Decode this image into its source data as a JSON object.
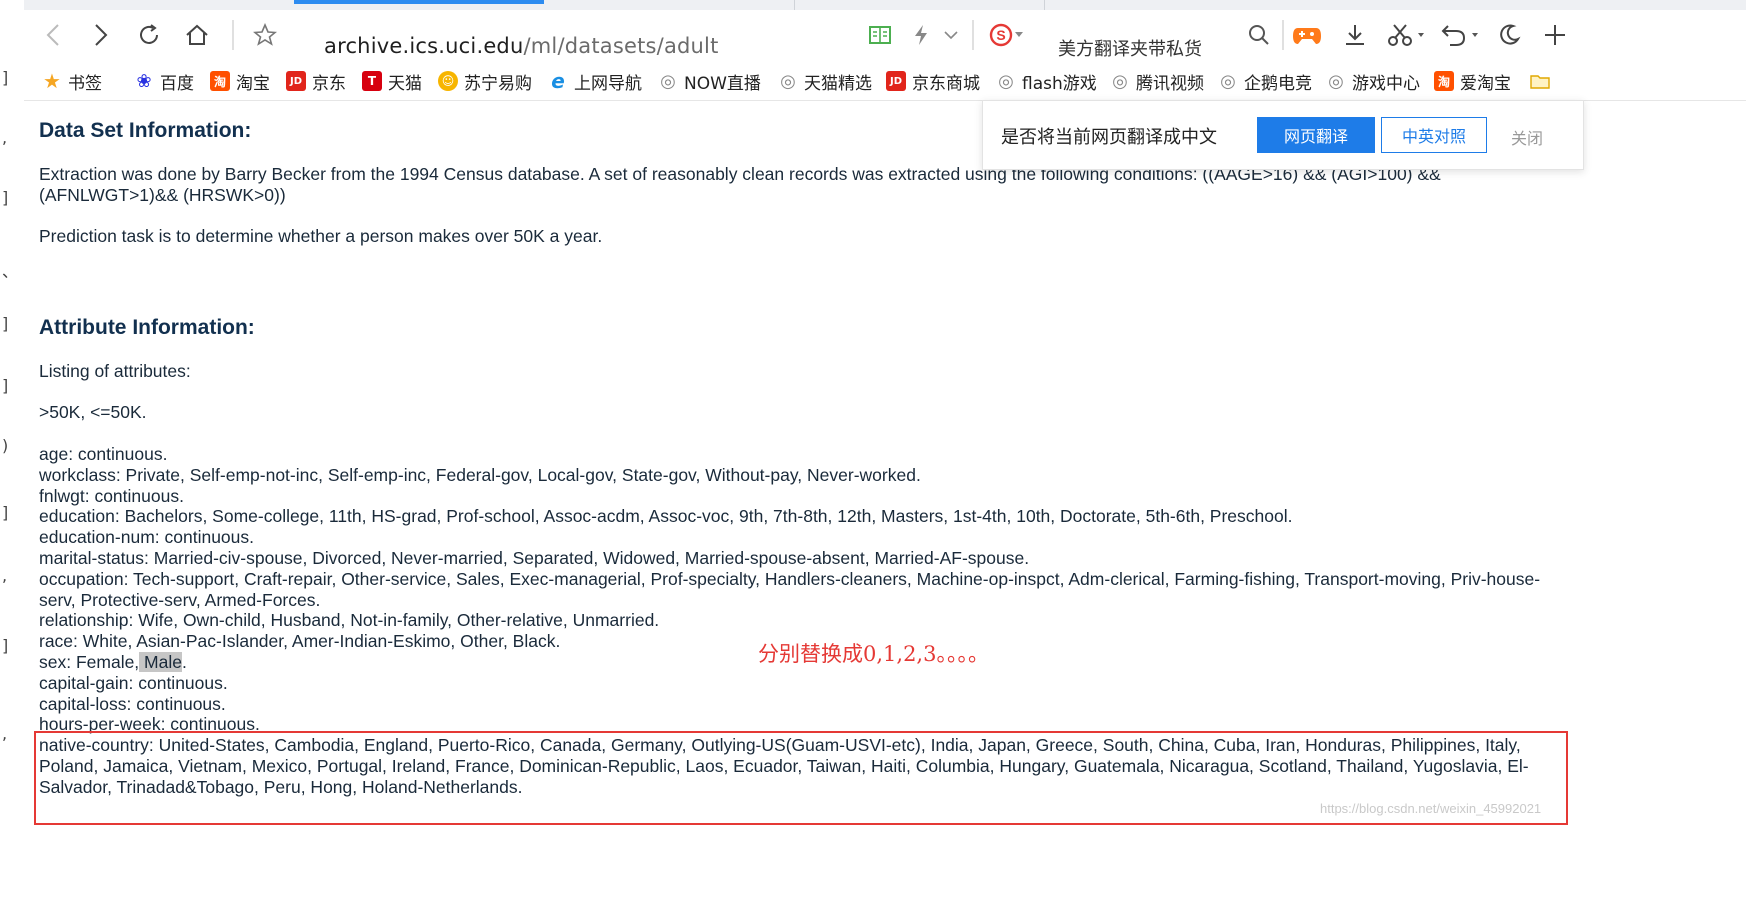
{
  "browser": {
    "url_host": "archive.ics.uci.edu",
    "url_path": "/ml/datasets/adult",
    "search_text": "美方翻译夹带私货"
  },
  "bookmarks": [
    {
      "label": "书签",
      "icon": "star-icon",
      "color": "#f5a623"
    },
    {
      "label": "百度",
      "icon": "baidu-paw-icon",
      "color": "#2932e1"
    },
    {
      "label": "淘宝",
      "icon": "taobao-icon",
      "color": "#ff5000"
    },
    {
      "label": "京东",
      "icon": "jd-icon",
      "color": "#e1251b"
    },
    {
      "label": "天猫",
      "icon": "tmall-icon",
      "color": "#d7000f"
    },
    {
      "label": "苏宁易购",
      "icon": "suning-icon",
      "color": "#f7b500"
    },
    {
      "label": "上网导航",
      "icon": "ie-icon",
      "color": "#1a8fe3"
    },
    {
      "label": "NOW直播",
      "icon": "globe-icon",
      "color": "#888888"
    },
    {
      "label": "天猫精选",
      "icon": "globe-icon",
      "color": "#888888"
    },
    {
      "label": "京东商城",
      "icon": "jd-icon",
      "color": "#e1251b"
    },
    {
      "label": "flash游戏",
      "icon": "globe-icon",
      "color": "#888888"
    },
    {
      "label": "腾讯视频",
      "icon": "globe-icon",
      "color": "#888888"
    },
    {
      "label": "企鹅电竞",
      "icon": "globe-icon",
      "color": "#888888"
    },
    {
      "label": "游戏中心",
      "icon": "globe-icon",
      "color": "#888888"
    },
    {
      "label": "爱淘宝",
      "icon": "taobao-icon",
      "color": "#ff5000"
    }
  ],
  "translate_popup": {
    "question": "是否将当前网页翻译成中文",
    "translate_button": "网页翻译",
    "bilingual_button": "中英对照",
    "close_label": "关闭"
  },
  "page": {
    "h_dataset": "Data Set Information:",
    "dataset_p1_line1": "Extraction was done by Barry Becker from the 1994 Census database. A set of reasonably clean records was extracted using the following conditions: ((AAGE>16) && (AGI>100) &&",
    "dataset_p1_line2": "(AFNLWGT>1)&& (HRSWK>0))",
    "dataset_p2": "Prediction task is to determine whether a person makes over 50K a year.",
    "h_attr": "Attribute Information:",
    "listing": "Listing of attributes:",
    "target": ">50K, <=50K.",
    "age": "age: continuous.",
    "workclass": "workclass: Private, Self-emp-not-inc, Self-emp-inc, Federal-gov, Local-gov, State-gov, Without-pay, Never-worked.",
    "fnlwgt": "fnlwgt: continuous.",
    "education": "education: Bachelors, Some-college, 11th, HS-grad, Prof-school, Assoc-acdm, Assoc-voc, 9th, 7th-8th, 12th, Masters, 1st-4th, 10th, Doctorate, 5th-6th, Preschool.",
    "education_num": "education-num: continuous.",
    "marital_status": "marital-status: Married-civ-spouse, Divorced, Never-married, Separated, Widowed, Married-spouse-absent, Married-AF-spouse.",
    "occupation_line1": "occupation: Tech-support, Craft-repair, Other-service, Sales, Exec-managerial, Prof-specialty, Handlers-cleaners, Machine-op-inspct, Adm-clerical, Farming-fishing, Transport-moving, Priv-house-",
    "occupation_line2": "serv, Protective-serv, Armed-Forces.",
    "relationship": "relationship: Wife, Own-child, Husband, Not-in-family, Other-relative, Unmarried.",
    "race": "race: White, Asian-Pac-Islander, Amer-Indian-Eskimo, Other, Black.",
    "sex_prefix": "sex: Female,",
    "sex_highlight": " Male",
    "sex_suffix": ".",
    "capital_gain": "capital-gain: continuous.",
    "capital_loss": "capital-loss: continuous.",
    "hours_per_week": "hours-per-week: continuous.",
    "native_line1": "native-country: United-States, Cambodia, England, Puerto-Rico, Canada, Germany, Outlying-US(Guam-USVI-etc), India, Japan, Greece, South, China, Cuba, Iran, Honduras, Philippines, Italy,",
    "native_line2": "Poland, Jamaica, Vietnam, Mexico, Portugal, Ireland, France, Dominican-Republic, Laos, Ecuador, Taiwan, Haiti, Columbia, Hungary, Guatemala, Nicaragua, Scotland, Thailand, Yugoslavia, El-",
    "native_line3": "Salvador, Trinadad&Tobago, Peru, Hong, Holand-Netherlands.",
    "annotation": "分别替换成0,1,2,3。。。。",
    "watermark": "https://blog.csdn.net/weixin_45992021"
  }
}
